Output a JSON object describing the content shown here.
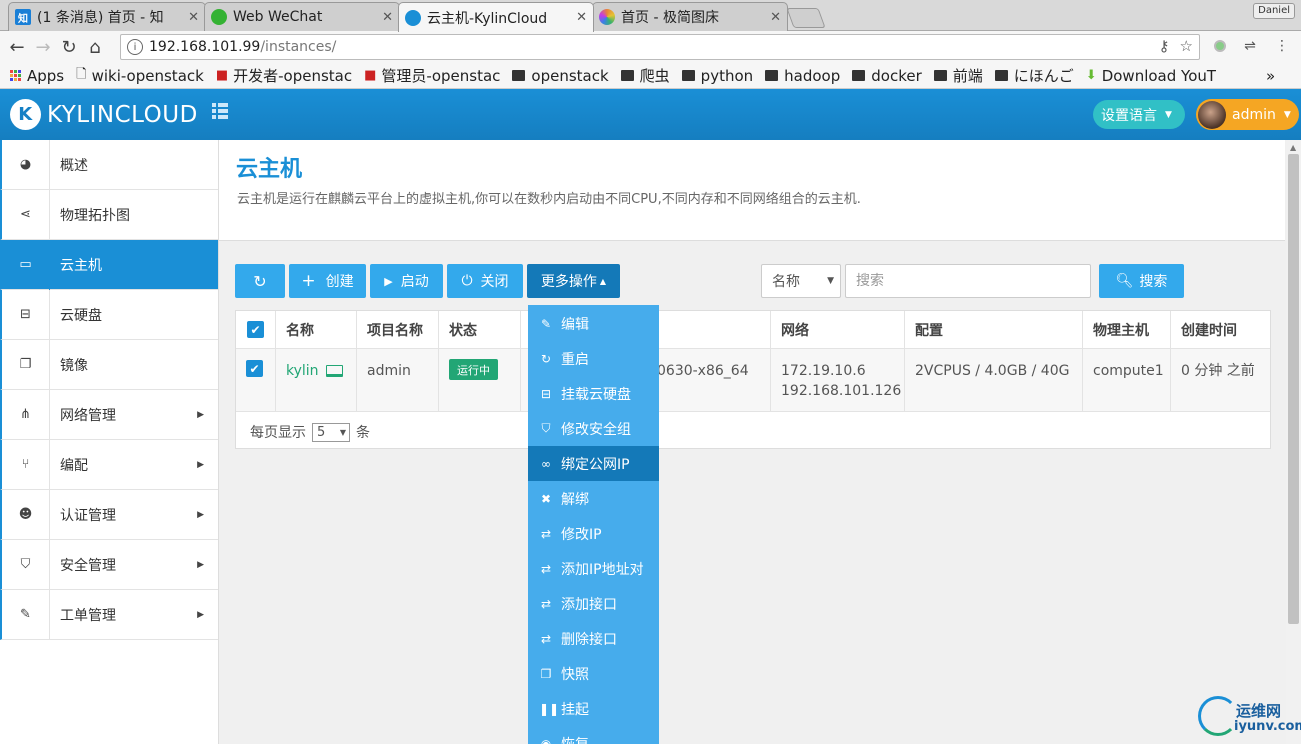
{
  "browser": {
    "tabs": [
      {
        "title": "(1 条消息) 首页 - 知",
        "icon": "知",
        "icon_color": "#1a7fd6"
      },
      {
        "title": "Web WeChat",
        "icon": "",
        "icon_color": "#34b233"
      },
      {
        "title": "云主机-KylinCloud",
        "icon": "",
        "icon_color": "#1a8fd6"
      },
      {
        "title": "首页 - 极简图床",
        "icon": "",
        "icon_color": "#e8833a"
      }
    ],
    "profile_name": "Daniel",
    "url_host": "192.168.101.99",
    "url_path": "/instances/",
    "bookmarks": [
      "Apps",
      "wiki-openstack",
      "开发者-openstac",
      "管理员-openstac",
      "openstack",
      "爬虫",
      "python",
      "hadoop",
      "docker",
      "前端",
      "にほんご",
      "Download YouT"
    ],
    "more_bookmarks": "»"
  },
  "app": {
    "brand": "KYLINCLOUD",
    "language_button": "设置语言",
    "user_name": "admin",
    "colors": {
      "primary": "#1a8fd6",
      "accent": "#31c0c6",
      "user": "#f5a623",
      "running": "#22a675"
    }
  },
  "sidebar": {
    "items": [
      {
        "label": "概述",
        "icon": "dashboard-icon",
        "glyph": "◕",
        "has_children": false,
        "active": false
      },
      {
        "label": "物理拓扑图",
        "icon": "share-icon",
        "glyph": "⋖",
        "has_children": false,
        "active": false
      },
      {
        "label": "云主机",
        "icon": "laptop-icon",
        "glyph": "▭",
        "has_children": false,
        "active": true
      },
      {
        "label": "云硬盘",
        "icon": "hdd-icon",
        "glyph": "⊟",
        "has_children": false,
        "active": false
      },
      {
        "label": "镜像",
        "icon": "copy-icon",
        "glyph": "❐",
        "has_children": false,
        "active": false
      },
      {
        "label": "网络管理",
        "icon": "sitemap-icon",
        "glyph": "⋔",
        "has_children": true,
        "active": false
      },
      {
        "label": "编配",
        "icon": "fork-icon",
        "glyph": "⑂",
        "has_children": true,
        "active": false
      },
      {
        "label": "认证管理",
        "icon": "users-icon",
        "glyph": "☻",
        "has_children": true,
        "active": false
      },
      {
        "label": "安全管理",
        "icon": "shield-icon",
        "glyph": "⛉",
        "has_children": true,
        "active": false
      },
      {
        "label": "工单管理",
        "icon": "edit-icon",
        "glyph": "✎",
        "has_children": true,
        "active": false
      }
    ]
  },
  "page": {
    "title": "云主机",
    "description": "云主机是运行在麒麟云平台上的虚拟主机,你可以在数秒内启动由不同CPU,不同内存和不同网络组合的云主机."
  },
  "actions": {
    "refresh_icon": "refresh-icon",
    "create": "创建",
    "start": "启动",
    "stop": "关闭",
    "more": "更多操作",
    "search_field": "名称",
    "search_placeholder": "搜索",
    "search_button": "搜索"
  },
  "table": {
    "columns": [
      "名称",
      "项目名称",
      "状态",
      "网络",
      "配置",
      "物理主机",
      "创建时间"
    ],
    "rows": [
      {
        "name": "kylin",
        "project": "admin",
        "status": "运行中",
        "image_fragment": "_0630-x86_64",
        "ip1": "172.19.10.6",
        "ip2": "192.168.101.126",
        "config": "2VCPUS / 4.0GB / 40G",
        "host": "compute1",
        "created": "0 分钟 之前",
        "checked": true
      }
    ],
    "page_size_prefix": "每页显示",
    "page_size": "5",
    "page_size_suffix": "条"
  },
  "dropdown": {
    "items": [
      {
        "label": "编辑",
        "icon": "edit-icon",
        "glyph": "✎"
      },
      {
        "label": "重启",
        "icon": "refresh-icon",
        "glyph": "↻"
      },
      {
        "label": "挂载云硬盘",
        "icon": "hdd-icon",
        "glyph": "⊟"
      },
      {
        "label": "修改安全组",
        "icon": "shield-icon",
        "glyph": "⛉"
      },
      {
        "label": "绑定公网IP",
        "icon": "link-icon",
        "glyph": "∞",
        "hover": true
      },
      {
        "label": "解绑",
        "icon": "close-icon",
        "glyph": "✖"
      },
      {
        "label": "修改IP",
        "icon": "exchange-icon",
        "glyph": "⇄"
      },
      {
        "label": "添加IP地址对",
        "icon": "exchange-icon",
        "glyph": "⇄"
      },
      {
        "label": "添加接口",
        "icon": "exchange-icon",
        "glyph": "⇄"
      },
      {
        "label": "删除接口",
        "icon": "exchange-icon",
        "glyph": "⇄"
      },
      {
        "label": "快照",
        "icon": "copy-icon",
        "glyph": "❐"
      },
      {
        "label": "挂起",
        "icon": "pause-icon",
        "glyph": "❚❚"
      },
      {
        "label": "恢复",
        "icon": "play-circle-icon",
        "glyph": "◉"
      }
    ]
  },
  "watermark": {
    "line1": "运维网",
    "line2": "iyunv.com"
  }
}
